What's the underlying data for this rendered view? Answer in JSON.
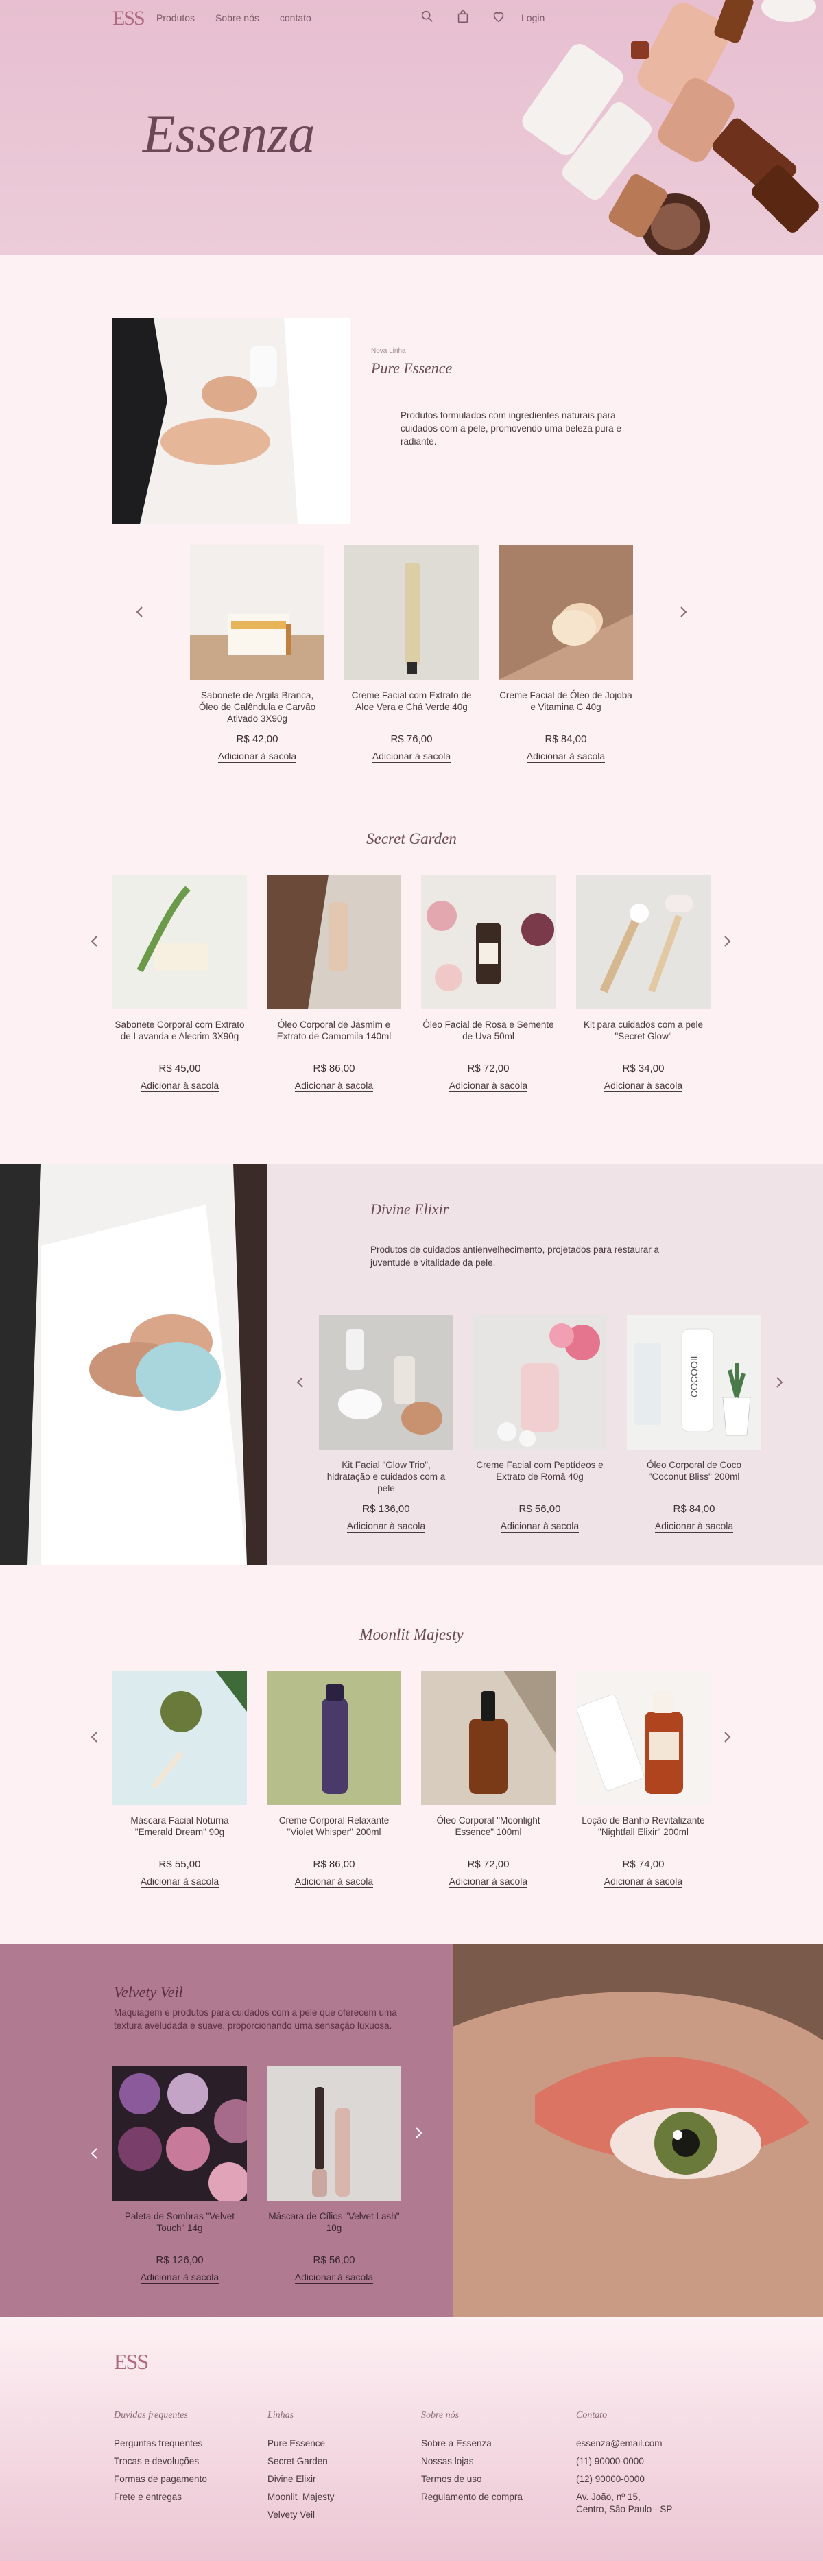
{
  "brand": {
    "logo": "ESS",
    "name": "Essenza"
  },
  "nav": {
    "links": [
      "Produtos",
      "Sobre nós",
      "contato"
    ],
    "login": "Login",
    "icons": [
      "search-icon",
      "bag-icon",
      "heart-icon"
    ]
  },
  "colors": {
    "background": "#fdf1f4",
    "hero": "#e7bfd0",
    "accent": "#b06a80",
    "divine_bg": "#efe3e8",
    "velvet_bg": "#b07a90",
    "text": "#4a3a3e"
  },
  "pure": {
    "kicker": "Nova Linha",
    "title": "Pure Essence",
    "description": "Produtos formulados com ingredientes naturais para cuidados com a pele, promovendo uma beleza pura e radiante.",
    "products": [
      {
        "name": "Sabonete de Argila Branca, Óleo de Calêndula e Carvão Ativado 3X90g",
        "price": "R$ 42,00",
        "cta": "Adicionar à sacola"
      },
      {
        "name": "Creme Facial com Extrato de Aloe Vera e Chá Verde 40g",
        "price": "R$ 76,00",
        "cta": "Adicionar à sacola"
      },
      {
        "name": "Creme Facial de Óleo de Jojoba e Vitamina C 40g",
        "price": "R$ 84,00",
        "cta": "Adicionar à sacola"
      }
    ]
  },
  "secret": {
    "title": "Secret Garden",
    "products": [
      {
        "name": "Sabonete Corporal com Extrato de Lavanda e Alecrim 3X90g",
        "price": "R$ 45,00",
        "cta": "Adicionar à sacola"
      },
      {
        "name": "Óleo Corporal de Jasmim e Extrato de Camomila 140ml",
        "price": "R$ 86,00",
        "cta": "Adicionar à sacola"
      },
      {
        "name": "Óleo Facial de Rosa e Semente de Uva 50ml",
        "price": "R$ 72,00",
        "cta": "Adicionar à sacola"
      },
      {
        "name": "Kit para cuidados com a pele \"Secret Glow\"",
        "price": "R$ 34,00",
        "cta": "Adicionar à sacola"
      }
    ]
  },
  "divine": {
    "title": "Divine Elixir",
    "description": "Produtos de cuidados antienvelhecimento, projetados para restaurar a juventude e vitalidade da pele.",
    "products": [
      {
        "name": "Kit Facial \"Glow Trio\", hidratação e cuidados com a pele",
        "price": "R$ 136,00",
        "cta": "Adicionar à sacola"
      },
      {
        "name": "Creme Facial com Peptídeos e Extrato de Romã 40g",
        "price": "R$ 56,00",
        "cta": "Adicionar à sacola"
      },
      {
        "name": "Óleo Corporal de Coco \"Coconut Bliss\" 200ml",
        "price": "R$ 84,00",
        "cta": "Adicionar à sacola"
      }
    ]
  },
  "moonlit": {
    "title": "Moonlit Majesty",
    "products": [
      {
        "name": "Máscara Facial Noturna \"Emerald Dream\" 90g",
        "price": "R$ 55,00",
        "cta": "Adicionar à sacola"
      },
      {
        "name": "Creme Corporal Relaxante \"Violet Whisper\" 200ml",
        "price": "R$ 86,00",
        "cta": "Adicionar à sacola"
      },
      {
        "name": "Óleo Corporal \"Moonlight Essence\" 100ml",
        "price": "R$ 72,00",
        "cta": "Adicionar à sacola"
      },
      {
        "name": "Loção de Banho Revitalizante \"Nightfall Elixir\" 200ml",
        "price": "R$ 74,00",
        "cta": "Adicionar à sacola"
      }
    ]
  },
  "velvet": {
    "title": "Velvety Veil",
    "description": "Maquiagem e produtos para cuidados com a pele que oferecem uma textura aveludada e suave, proporcionando uma sensação luxuosa.",
    "products": [
      {
        "name": "Paleta de Sombras \"Velvet Touch\" 14g",
        "price": "R$ 126,00",
        "cta": "Adicionar à sacola"
      },
      {
        "name": "Máscara de Cílios \"Velvet Lash\" 10g",
        "price": "R$ 56,00",
        "cta": "Adicionar à sacola"
      }
    ]
  },
  "footer": {
    "logo": "ESS",
    "columns": [
      {
        "title": "Duvidas frequentes",
        "items": [
          "Perguntas frequentes",
          "Trocas e devoluções",
          "Formas de pagamento",
          "Frete e entregas"
        ]
      },
      {
        "title": "Linhas",
        "items": [
          "Pure Essence",
          "Secret Garden",
          "Divine Elixir",
          "Moonlit  Majesty",
          "Velvety Veil"
        ]
      },
      {
        "title": "Sobre nós",
        "items": [
          "Sobre a Essenza",
          "Nossas lojas",
          "Termos de uso",
          "Regulamento de compra"
        ]
      },
      {
        "title": "Contato",
        "items": [
          "essenza@email.com",
          "(11) 90000-0000",
          "(12) 90000-0000",
          "Av. João, nº 15,",
          "Centro, São Paulo - SP"
        ]
      }
    ]
  }
}
